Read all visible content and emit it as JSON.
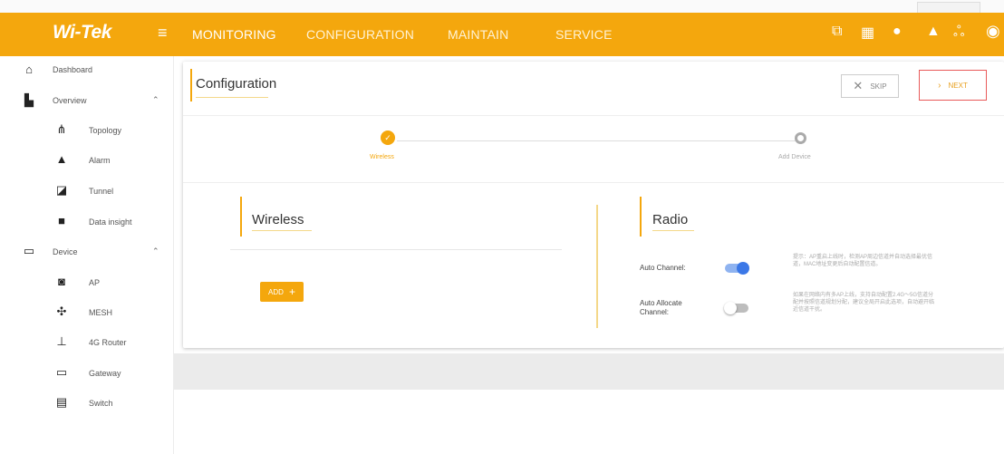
{
  "header": {
    "logo": "Wi-Tek",
    "nav": [
      "MONITORING",
      "CONFIGURATION",
      "MAINTAIN",
      "SERVICE"
    ],
    "icons": [
      "cube-icon",
      "qr-icon",
      "chat-icon",
      "bell-icon",
      "people-icon",
      "user-icon"
    ]
  },
  "sidebar": {
    "dashboard": "Dashboard",
    "overview": "Overview",
    "topology": "Topology",
    "alarm": "Alarm",
    "tunnel": "Tunnel",
    "data_insight": "Data insight",
    "device": "Device",
    "ap": "AP",
    "mesh": "MESH",
    "router": "4G Router",
    "gateway": "Gateway",
    "switch": "Switch"
  },
  "config": {
    "title": "Configuration",
    "skip": "SKIP",
    "next": "NEXT",
    "steps": [
      "Wireless",
      "Add Device"
    ]
  },
  "wireless": {
    "title": "Wireless",
    "add": "ADD"
  },
  "radio": {
    "title": "Radio",
    "auto_channel": "Auto Channel:",
    "auto_allocate": "Auto Allocate Channel:",
    "auto_channel_on": true,
    "auto_allocate_on": false,
    "hint1": "提示：AP重启上线时，检测AP周边信道并自动选择最优信道，MAC地址变更后自动配置信道。",
    "hint2": "如果在网络内有多AP上线，支持自动配置2.4G～5G信道分配并按照信道规划分配，建议全局开启此选项，自动避开临近信道干扰。"
  },
  "colors": {
    "brand": "#f4a70d",
    "toggle_on": "#3b78e7",
    "next_border": "#e85a5a"
  }
}
